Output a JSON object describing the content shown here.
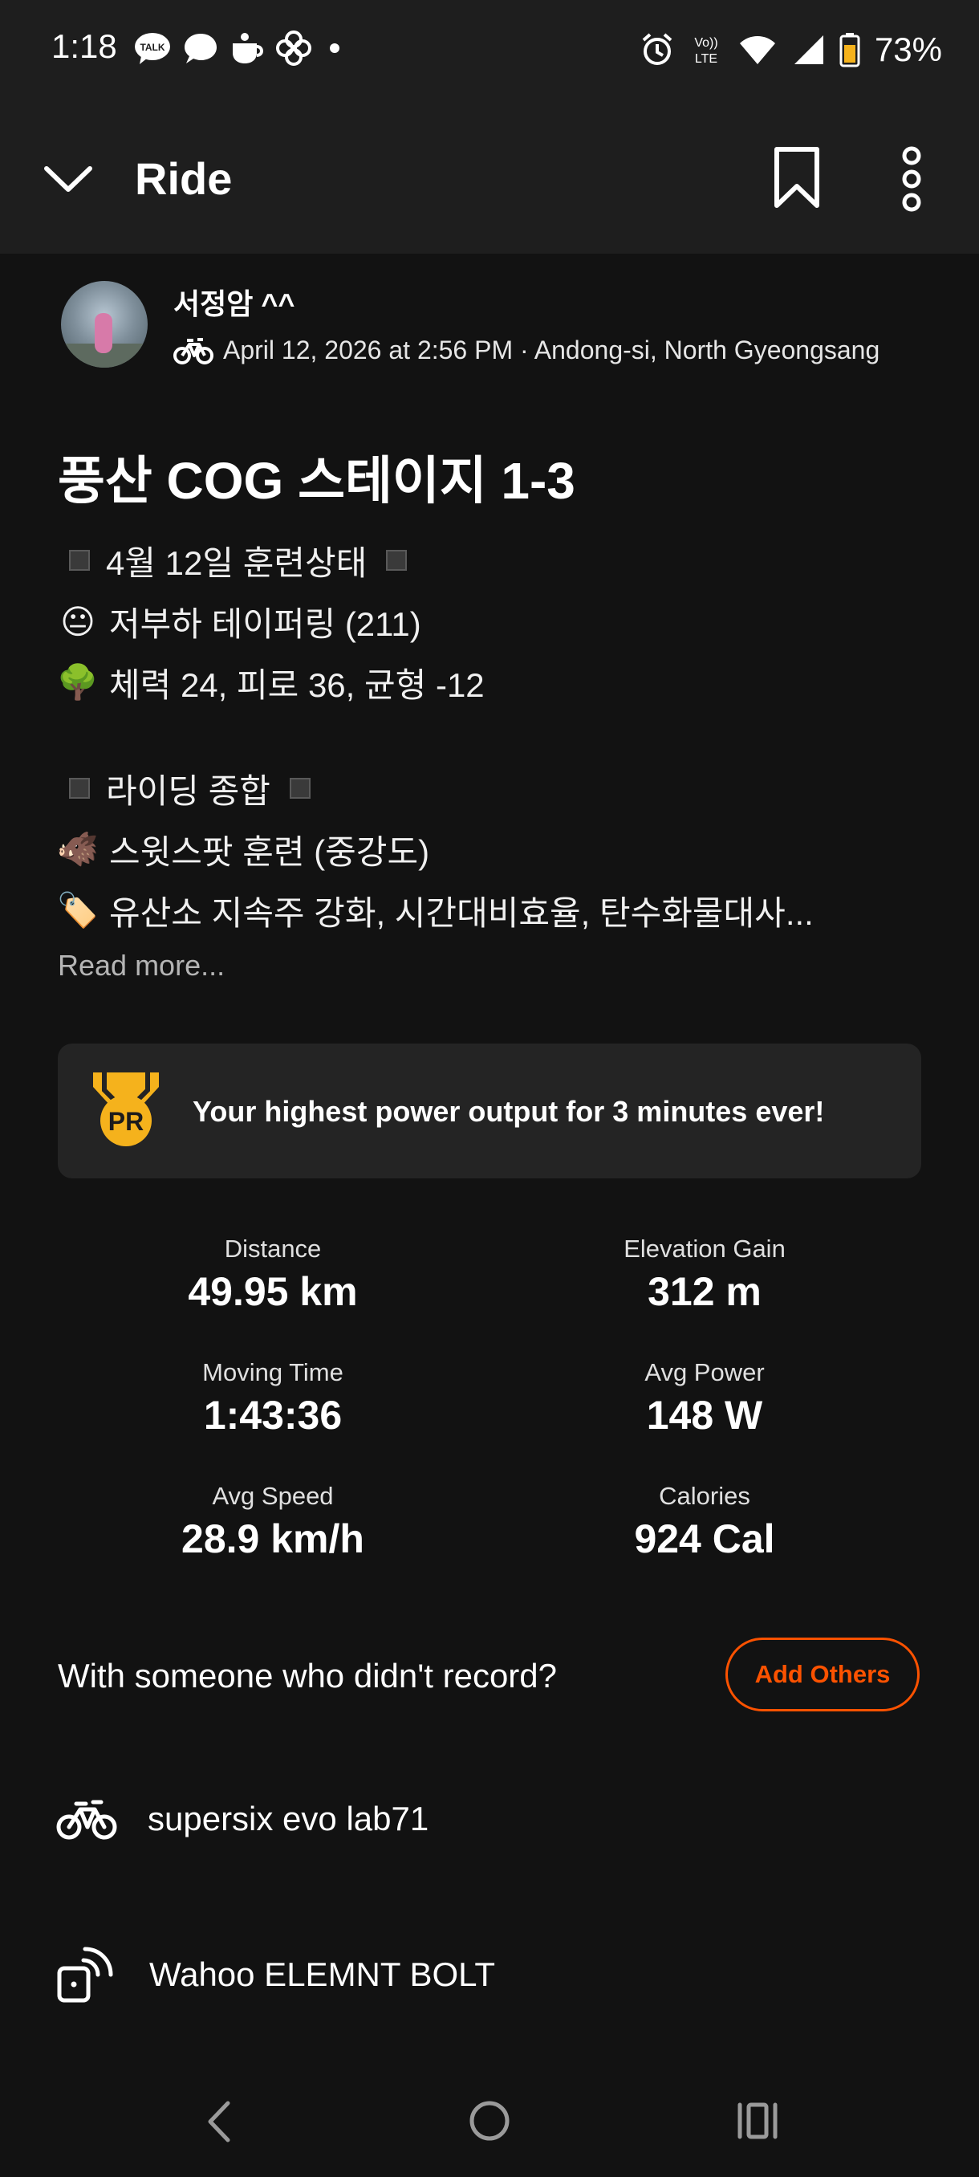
{
  "status": {
    "time": "1:18",
    "battery": "73%",
    "left_icons": [
      "kakaotalk-icon",
      "chat-bubble-icon",
      "cup-icon",
      "pinwheel-icon",
      "dot-icon"
    ],
    "right_icons": [
      "alarm-icon",
      "volte-icon",
      "wifi-icon",
      "signal-icon",
      "battery-icon"
    ]
  },
  "app_bar": {
    "title": "Ride"
  },
  "athlete": {
    "name": "서정암 ^^",
    "meta": "April 12, 2026 at 2:56 PM · Andong-si, North Gyeongsang"
  },
  "activity": {
    "title": "풍산  COG 스테이지 1-3",
    "description": [
      {
        "icon": "square",
        "text": "4월 12일 훈련상태",
        "trail": true
      },
      {
        "icon": "😐",
        "text": "저부하 테이퍼링 (211)"
      },
      {
        "icon": "🌳",
        "text": "체력 24, 피로 36, 균형 -12"
      },
      {
        "gap": true
      },
      {
        "icon": "square",
        "text": "라이딩 종합",
        "trail": true
      },
      {
        "icon": "🐗",
        "text": "스윗스팟 훈련 (중강도)"
      },
      {
        "icon": "🏷️",
        "text": "유산소 지속주 강화, 시간대비효율, 탄수화물대사..."
      }
    ],
    "read_more": "Read more..."
  },
  "pr": {
    "badge": "PR",
    "text": "Your highest power output for 3 minutes ever!"
  },
  "stats": [
    {
      "label": "Distance",
      "value": "49.95 km"
    },
    {
      "label": "Elevation Gain",
      "value": "312 m"
    },
    {
      "label": "Moving Time",
      "value": "1:43:36"
    },
    {
      "label": "Avg Power",
      "value": "148 W"
    },
    {
      "label": "Avg Speed",
      "value": "28.9 km/h"
    },
    {
      "label": "Calories",
      "value": "924 Cal"
    }
  ],
  "with_others": {
    "prompt": "With someone who didn't record?",
    "button": "Add Others"
  },
  "gear": {
    "bike": "supersix evo lab71",
    "device": "Wahoo ELEMNT BOLT"
  },
  "colors": {
    "accent": "#fc5200",
    "background": "#121212",
    "bar": "#1e1e1e",
    "pr_gold": "#f5b21c"
  }
}
